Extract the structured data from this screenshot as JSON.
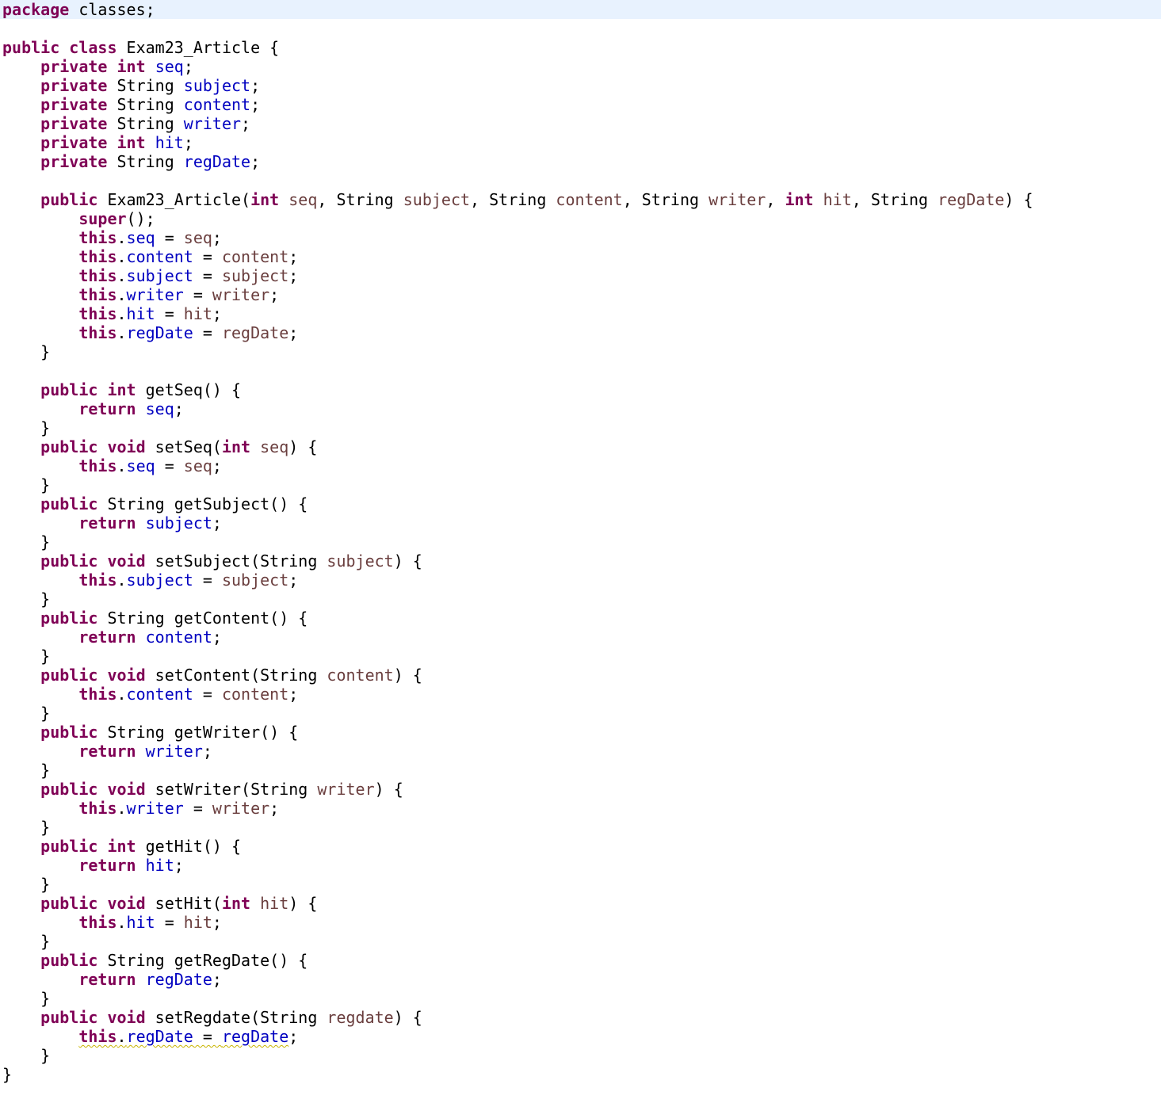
{
  "editor": {
    "language": "java",
    "current_line": 0,
    "colors": {
      "keyword": "#7f0055",
      "field": "#0000c0",
      "parameter": "#6a3e3e",
      "plain": "#000000",
      "current_line_bg": "#e8f2fe",
      "warning_underline": "#c8b400"
    },
    "lines": [
      [
        {
          "t": "package",
          "s": "kw"
        },
        {
          "t": " classes;"
        }
      ],
      [],
      [
        {
          "t": "public",
          "s": "kw"
        },
        {
          "t": " "
        },
        {
          "t": "class",
          "s": "kw"
        },
        {
          "t": " Exam23_Article {"
        }
      ],
      [
        {
          "t": "    "
        },
        {
          "t": "private",
          "s": "kw"
        },
        {
          "t": " "
        },
        {
          "t": "int",
          "s": "kw"
        },
        {
          "t": " "
        },
        {
          "t": "seq",
          "s": "fld"
        },
        {
          "t": ";"
        }
      ],
      [
        {
          "t": "    "
        },
        {
          "t": "private",
          "s": "kw"
        },
        {
          "t": " String "
        },
        {
          "t": "subject",
          "s": "fld"
        },
        {
          "t": ";"
        }
      ],
      [
        {
          "t": "    "
        },
        {
          "t": "private",
          "s": "kw"
        },
        {
          "t": " String "
        },
        {
          "t": "content",
          "s": "fld"
        },
        {
          "t": ";"
        }
      ],
      [
        {
          "t": "    "
        },
        {
          "t": "private",
          "s": "kw"
        },
        {
          "t": " String "
        },
        {
          "t": "writer",
          "s": "fld"
        },
        {
          "t": ";"
        }
      ],
      [
        {
          "t": "    "
        },
        {
          "t": "private",
          "s": "kw"
        },
        {
          "t": " "
        },
        {
          "t": "int",
          "s": "kw"
        },
        {
          "t": " "
        },
        {
          "t": "hit",
          "s": "fld"
        },
        {
          "t": ";"
        }
      ],
      [
        {
          "t": "    "
        },
        {
          "t": "private",
          "s": "kw"
        },
        {
          "t": " String "
        },
        {
          "t": "regDate",
          "s": "fld"
        },
        {
          "t": ";"
        }
      ],
      [],
      [
        {
          "t": "    "
        },
        {
          "t": "public",
          "s": "kw"
        },
        {
          "t": " Exam23_Article("
        },
        {
          "t": "int",
          "s": "kw"
        },
        {
          "t": " "
        },
        {
          "t": "seq",
          "s": "prm"
        },
        {
          "t": ", String "
        },
        {
          "t": "subject",
          "s": "prm"
        },
        {
          "t": ", String "
        },
        {
          "t": "content",
          "s": "prm"
        },
        {
          "t": ", String "
        },
        {
          "t": "writer",
          "s": "prm"
        },
        {
          "t": ", "
        },
        {
          "t": "int",
          "s": "kw"
        },
        {
          "t": " "
        },
        {
          "t": "hit",
          "s": "prm"
        },
        {
          "t": ", String "
        },
        {
          "t": "regDate",
          "s": "prm"
        },
        {
          "t": ") {"
        }
      ],
      [
        {
          "t": "        "
        },
        {
          "t": "super",
          "s": "kw"
        },
        {
          "t": "();"
        }
      ],
      [
        {
          "t": "        "
        },
        {
          "t": "this",
          "s": "kw"
        },
        {
          "t": "."
        },
        {
          "t": "seq",
          "s": "fld"
        },
        {
          "t": " = "
        },
        {
          "t": "seq",
          "s": "prm"
        },
        {
          "t": ";"
        }
      ],
      [
        {
          "t": "        "
        },
        {
          "t": "this",
          "s": "kw"
        },
        {
          "t": "."
        },
        {
          "t": "content",
          "s": "fld"
        },
        {
          "t": " = "
        },
        {
          "t": "content",
          "s": "prm"
        },
        {
          "t": ";"
        }
      ],
      [
        {
          "t": "        "
        },
        {
          "t": "this",
          "s": "kw"
        },
        {
          "t": "."
        },
        {
          "t": "subject",
          "s": "fld"
        },
        {
          "t": " = "
        },
        {
          "t": "subject",
          "s": "prm"
        },
        {
          "t": ";"
        }
      ],
      [
        {
          "t": "        "
        },
        {
          "t": "this",
          "s": "kw"
        },
        {
          "t": "."
        },
        {
          "t": "writer",
          "s": "fld"
        },
        {
          "t": " = "
        },
        {
          "t": "writer",
          "s": "prm"
        },
        {
          "t": ";"
        }
      ],
      [
        {
          "t": "        "
        },
        {
          "t": "this",
          "s": "kw"
        },
        {
          "t": "."
        },
        {
          "t": "hit",
          "s": "fld"
        },
        {
          "t": " = "
        },
        {
          "t": "hit",
          "s": "prm"
        },
        {
          "t": ";"
        }
      ],
      [
        {
          "t": "        "
        },
        {
          "t": "this",
          "s": "kw"
        },
        {
          "t": "."
        },
        {
          "t": "regDate",
          "s": "fld"
        },
        {
          "t": " = "
        },
        {
          "t": "regDate",
          "s": "prm"
        },
        {
          "t": ";"
        }
      ],
      [
        {
          "t": "    }"
        }
      ],
      [],
      [
        {
          "t": "    "
        },
        {
          "t": "public",
          "s": "kw"
        },
        {
          "t": " "
        },
        {
          "t": "int",
          "s": "kw"
        },
        {
          "t": " getSeq() {"
        }
      ],
      [
        {
          "t": "        "
        },
        {
          "t": "return",
          "s": "kw"
        },
        {
          "t": " "
        },
        {
          "t": "seq",
          "s": "fld"
        },
        {
          "t": ";"
        }
      ],
      [
        {
          "t": "    }"
        }
      ],
      [
        {
          "t": "    "
        },
        {
          "t": "public",
          "s": "kw"
        },
        {
          "t": " "
        },
        {
          "t": "void",
          "s": "kw"
        },
        {
          "t": " setSeq("
        },
        {
          "t": "int",
          "s": "kw"
        },
        {
          "t": " "
        },
        {
          "t": "seq",
          "s": "prm"
        },
        {
          "t": ") {"
        }
      ],
      [
        {
          "t": "        "
        },
        {
          "t": "this",
          "s": "kw"
        },
        {
          "t": "."
        },
        {
          "t": "seq",
          "s": "fld"
        },
        {
          "t": " = "
        },
        {
          "t": "seq",
          "s": "prm"
        },
        {
          "t": ";"
        }
      ],
      [
        {
          "t": "    }"
        }
      ],
      [
        {
          "t": "    "
        },
        {
          "t": "public",
          "s": "kw"
        },
        {
          "t": " String getSubject() {"
        }
      ],
      [
        {
          "t": "        "
        },
        {
          "t": "return",
          "s": "kw"
        },
        {
          "t": " "
        },
        {
          "t": "subject",
          "s": "fld"
        },
        {
          "t": ";"
        }
      ],
      [
        {
          "t": "    }"
        }
      ],
      [
        {
          "t": "    "
        },
        {
          "t": "public",
          "s": "kw"
        },
        {
          "t": " "
        },
        {
          "t": "void",
          "s": "kw"
        },
        {
          "t": " setSubject(String "
        },
        {
          "t": "subject",
          "s": "prm"
        },
        {
          "t": ") {"
        }
      ],
      [
        {
          "t": "        "
        },
        {
          "t": "this",
          "s": "kw"
        },
        {
          "t": "."
        },
        {
          "t": "subject",
          "s": "fld"
        },
        {
          "t": " = "
        },
        {
          "t": "subject",
          "s": "prm"
        },
        {
          "t": ";"
        }
      ],
      [
        {
          "t": "    }"
        }
      ],
      [
        {
          "t": "    "
        },
        {
          "t": "public",
          "s": "kw"
        },
        {
          "t": " String getContent() {"
        }
      ],
      [
        {
          "t": "        "
        },
        {
          "t": "return",
          "s": "kw"
        },
        {
          "t": " "
        },
        {
          "t": "content",
          "s": "fld"
        },
        {
          "t": ";"
        }
      ],
      [
        {
          "t": "    }"
        }
      ],
      [
        {
          "t": "    "
        },
        {
          "t": "public",
          "s": "kw"
        },
        {
          "t": " "
        },
        {
          "t": "void",
          "s": "kw"
        },
        {
          "t": " setContent(String "
        },
        {
          "t": "content",
          "s": "prm"
        },
        {
          "t": ") {"
        }
      ],
      [
        {
          "t": "        "
        },
        {
          "t": "this",
          "s": "kw"
        },
        {
          "t": "."
        },
        {
          "t": "content",
          "s": "fld"
        },
        {
          "t": " = "
        },
        {
          "t": "content",
          "s": "prm"
        },
        {
          "t": ";"
        }
      ],
      [
        {
          "t": "    }"
        }
      ],
      [
        {
          "t": "    "
        },
        {
          "t": "public",
          "s": "kw"
        },
        {
          "t": " String getWriter() {"
        }
      ],
      [
        {
          "t": "        "
        },
        {
          "t": "return",
          "s": "kw"
        },
        {
          "t": " "
        },
        {
          "t": "writer",
          "s": "fld"
        },
        {
          "t": ";"
        }
      ],
      [
        {
          "t": "    }"
        }
      ],
      [
        {
          "t": "    "
        },
        {
          "t": "public",
          "s": "kw"
        },
        {
          "t": " "
        },
        {
          "t": "void",
          "s": "kw"
        },
        {
          "t": " setWriter(String "
        },
        {
          "t": "writer",
          "s": "prm"
        },
        {
          "t": ") {"
        }
      ],
      [
        {
          "t": "        "
        },
        {
          "t": "this",
          "s": "kw"
        },
        {
          "t": "."
        },
        {
          "t": "writer",
          "s": "fld"
        },
        {
          "t": " = "
        },
        {
          "t": "writer",
          "s": "prm"
        },
        {
          "t": ";"
        }
      ],
      [
        {
          "t": "    }"
        }
      ],
      [
        {
          "t": "    "
        },
        {
          "t": "public",
          "s": "kw"
        },
        {
          "t": " "
        },
        {
          "t": "int",
          "s": "kw"
        },
        {
          "t": " getHit() {"
        }
      ],
      [
        {
          "t": "        "
        },
        {
          "t": "return",
          "s": "kw"
        },
        {
          "t": " "
        },
        {
          "t": "hit",
          "s": "fld"
        },
        {
          "t": ";"
        }
      ],
      [
        {
          "t": "    }"
        }
      ],
      [
        {
          "t": "    "
        },
        {
          "t": "public",
          "s": "kw"
        },
        {
          "t": " "
        },
        {
          "t": "void",
          "s": "kw"
        },
        {
          "t": " setHit("
        },
        {
          "t": "int",
          "s": "kw"
        },
        {
          "t": " "
        },
        {
          "t": "hit",
          "s": "prm"
        },
        {
          "t": ") {"
        }
      ],
      [
        {
          "t": "        "
        },
        {
          "t": "this",
          "s": "kw"
        },
        {
          "t": "."
        },
        {
          "t": "hit",
          "s": "fld"
        },
        {
          "t": " = "
        },
        {
          "t": "hit",
          "s": "prm"
        },
        {
          "t": ";"
        }
      ],
      [
        {
          "t": "    }"
        }
      ],
      [
        {
          "t": "    "
        },
        {
          "t": "public",
          "s": "kw"
        },
        {
          "t": " String getRegDate() {"
        }
      ],
      [
        {
          "t": "        "
        },
        {
          "t": "return",
          "s": "kw"
        },
        {
          "t": " "
        },
        {
          "t": "regDate",
          "s": "fld"
        },
        {
          "t": ";"
        }
      ],
      [
        {
          "t": "    }"
        }
      ],
      [
        {
          "t": "    "
        },
        {
          "t": "public",
          "s": "kw"
        },
        {
          "t": " "
        },
        {
          "t": "void",
          "s": "kw"
        },
        {
          "t": " setRegdate(String "
        },
        {
          "t": "regdate",
          "s": "prm"
        },
        {
          "t": ") {"
        }
      ],
      [
        {
          "t": "        "
        },
        {
          "t": "this",
          "s": "kw",
          "w": true
        },
        {
          "t": ".",
          "w": true
        },
        {
          "t": "regDate",
          "s": "fld",
          "w": true
        },
        {
          "t": " = ",
          "w": true
        },
        {
          "t": "regDate",
          "s": "fld",
          "w": true
        },
        {
          "t": ";"
        }
      ],
      [
        {
          "t": "    }"
        }
      ],
      [
        {
          "t": "}"
        }
      ]
    ]
  }
}
